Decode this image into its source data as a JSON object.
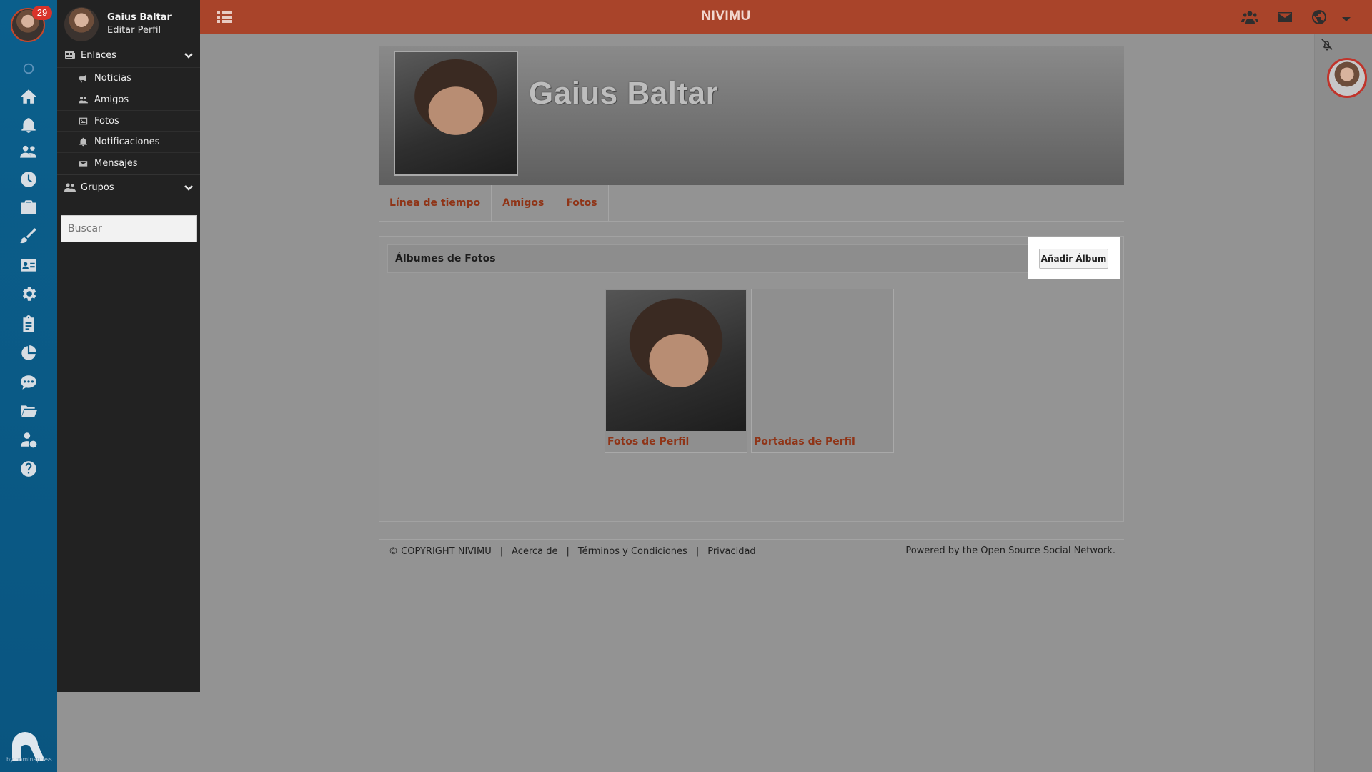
{
  "rail": {
    "badge": "29",
    "icons": [
      "circle-icon",
      "home-icon",
      "bell-icon",
      "users-icon",
      "clock-icon",
      "briefcase-icon",
      "brush-icon",
      "contact-card-icon",
      "gear-icon",
      "clipboard-icon",
      "pie-chart-icon",
      "chat-icon",
      "folder-icon",
      "user-dollar-icon",
      "help-icon"
    ],
    "logo_text": "by nominapress"
  },
  "sidebar": {
    "user_name": "Gaius Baltar",
    "edit_profile": "Editar Perfil",
    "links_section": "Enlaces",
    "links": [
      {
        "label": "Noticias",
        "icon": "megaphone-icon"
      },
      {
        "label": "Amigos",
        "icon": "users-icon"
      },
      {
        "label": "Fotos",
        "icon": "image-icon"
      },
      {
        "label": "Notificaciones",
        "icon": "bell-icon"
      },
      {
        "label": "Mensajes",
        "icon": "envelope-icon"
      }
    ],
    "groups_section": "Grupos",
    "search_placeholder": "Buscar"
  },
  "topbar": {
    "title": "NIVIMU",
    "icons": [
      "users-icon",
      "envelope-icon",
      "globe-icon",
      "caret-down-icon"
    ]
  },
  "profile": {
    "name": "Gaius Baltar",
    "tabs": [
      "Línea de tiempo",
      "Amigos",
      "Fotos"
    ]
  },
  "albums": {
    "title": "Álbumes de Fotos",
    "add_button": "Añadir Álbum",
    "items": [
      {
        "label": "Fotos de Perfil"
      },
      {
        "label": "Portadas de Perfil"
      }
    ]
  },
  "footer": {
    "copyright": "© COPYRIGHT NIVIMU",
    "about": "Acerca de",
    "terms": "Términos y Condiciones",
    "privacy": "Privacidad",
    "powered": "Powered by the Open Source Social Network."
  },
  "colors": {
    "topbar": "#a9442a",
    "rail": "#0b5f8c",
    "sidebar": "#222222",
    "link": "#8f3417",
    "badge": "#d9332b"
  }
}
